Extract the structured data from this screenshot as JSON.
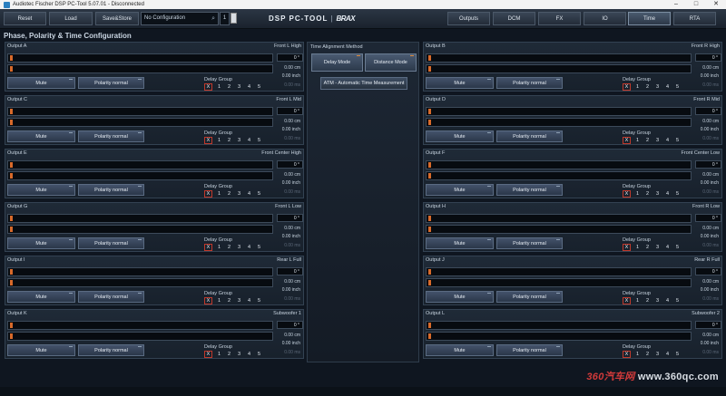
{
  "window": {
    "title": "Audiotec Fischer DSP PC-Tool 5.07.01 - Disconnected"
  },
  "toolbar": {
    "reset": "Reset",
    "load": "Load",
    "save_store": "Save&Store",
    "config_name": "No Configuration",
    "config_number": "1",
    "logo_text": "DSP PC-TOOL",
    "logo_sep": "|",
    "logo_brand": "BRAX",
    "tabs": [
      "Outputs",
      "DCM",
      "FX",
      "IO",
      "Time",
      "RTA"
    ],
    "active_tab": "Time"
  },
  "section_title": "Phase, Polarity & Time Configuration",
  "common": {
    "mute": "Mute",
    "polarity": "Polarity normal",
    "delay_group": "Delay Group",
    "delay_group_options": [
      "X",
      "1",
      "2",
      "3",
      "4",
      "5"
    ],
    "phase_value": "0 °",
    "cm_value": "0.00 cm",
    "inch_value": "0.00 inch",
    "ms_value": "0.00 ms"
  },
  "outputs_left": [
    {
      "id": "Output A",
      "name": "Front L High"
    },
    {
      "id": "Output C",
      "name": "Front L Mid"
    },
    {
      "id": "Output E",
      "name": "Front Center High"
    },
    {
      "id": "Output G",
      "name": "Front L Low"
    },
    {
      "id": "Output I",
      "name": "Rear L Full"
    },
    {
      "id": "Output K",
      "name": "Subwoofer 1"
    }
  ],
  "outputs_right": [
    {
      "id": "Output B",
      "name": "Front R High"
    },
    {
      "id": "Output D",
      "name": "Front R Mid"
    },
    {
      "id": "Output F",
      "name": "Front Center Low"
    },
    {
      "id": "Output H",
      "name": "Front R Low"
    },
    {
      "id": "Output J",
      "name": "Rear R Full"
    },
    {
      "id": "Output L",
      "name": "Subwoofer 2"
    }
  ],
  "time_alignment": {
    "title": "Time Alignment Method",
    "delay_mode": "Delay Mode",
    "distance_mode": "Distance Mode",
    "atm": "ATM - Automatic Time Measurement"
  },
  "watermark": {
    "brand": "360汽车网",
    "url": "www.360qc.com"
  }
}
